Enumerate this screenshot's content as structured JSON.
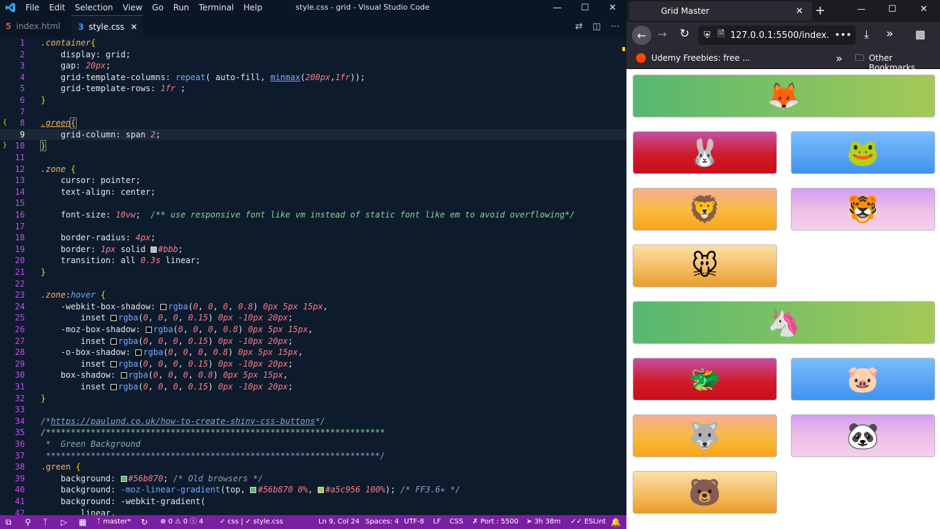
{
  "vscode": {
    "menu": [
      "File",
      "Edit",
      "Selection",
      "View",
      "Go",
      "Run",
      "Terminal",
      "Help"
    ],
    "title": "style.css - grid - Visual Studio Code",
    "tabs": [
      {
        "label": "index.html",
        "icon": "5"
      },
      {
        "label": "style.css",
        "icon": "3"
      }
    ],
    "lines": [
      {
        "n": "1",
        "html": "<span class='t-sel'>.container</span><span class='t-br'>{</span>"
      },
      {
        "n": "2",
        "html": "    <span class='t-prop'>display</span>: grid;"
      },
      {
        "n": "3",
        "html": "    <span class='t-prop'>gap</span>: <span class='t-num'>20px</span>;"
      },
      {
        "n": "4",
        "html": "    <span class='t-prop'>grid-template-columns</span>: <span class='t-fn'>repeat</span>( auto-fill, <span class='t-fn' style='text-decoration:underline'>minmax</span>(<span class='t-num'>200px</span>,<span class='t-num'>1fr</span>));"
      },
      {
        "n": "5",
        "html": "    <span class='t-prop'>grid-template-rows</span>: <span class='t-num'>1fr</span> ;"
      },
      {
        "n": "6",
        "html": "<span class='t-br'>}</span>"
      },
      {
        "n": "7",
        "html": ""
      },
      {
        "n": "8",
        "html": "<span class='t-sel' style='text-decoration:underline'>.green</span><span class='t-br' style='outline:1px solid #888'>{</span>"
      },
      {
        "n": "9",
        "html": "    <span class='t-prop'>grid-column</span>: span <span class='t-num'>2</span>;"
      },
      {
        "n": "10",
        "html": "<span class='t-br' style='outline:1px solid #888'>}</span>"
      },
      {
        "n": "11",
        "html": ""
      },
      {
        "n": "12",
        "html": "<span class='t-sel'>.zone</span> <span class='t-br'>{</span>"
      },
      {
        "n": "13",
        "html": "    <span class='t-prop'>cursor</span>: pointer;"
      },
      {
        "n": "14",
        "html": "    <span class='t-prop'>text-align</span>: center;"
      },
      {
        "n": "15",
        "html": ""
      },
      {
        "n": "16",
        "html": "    <span class='t-prop'>font-size</span>: <span class='t-num'>10vw</span>;  <span class='t-com-green'>/** use responsive font like vm instead of static font like em to avoid overflowing*/</span>"
      },
      {
        "n": "17",
        "html": ""
      },
      {
        "n": "18",
        "html": "    <span class='t-prop'>border-radius</span>: <span class='t-num'>4px</span>;"
      },
      {
        "n": "19",
        "html": "    <span class='t-prop'>border</span>: <span class='t-num'>1px</span> solid <span class='sw' style='background:#bbb'></span><span class='t-num'>#bbb</span>;"
      },
      {
        "n": "20",
        "html": "    <span class='t-prop'>transition</span>: all <span class='t-num'>0.3s</span> linear;"
      },
      {
        "n": "21",
        "html": "<span class='t-br'>}</span>"
      },
      {
        "n": "22",
        "html": ""
      },
      {
        "n": "23",
        "html": "<span class='t-sel'>.zone</span><span class='t-pun'>:</span><span class='t-fn' style='font-style:italic'>hover</span> <span class='t-br'>{</span>"
      },
      {
        "n": "24",
        "html": "    <span class='t-prop'>-webkit-box-shadow</span>: <span class='sw' style='background:#000'></span><span class='t-fn'>rgba</span>(<span class='t-num'>0</span>, <span class='t-num'>0</span>, <span class='t-num'>0</span>, <span class='t-num'>0.8</span>) <span class='t-num'>0px</span> <span class='t-num'>5px</span> <span class='t-num'>15px</span>,"
      },
      {
        "n": "25",
        "html": "        inset <span class='sw' style='background:#000'></span><span class='t-fn'>rgba</span>(<span class='t-num'>0</span>, <span class='t-num'>0</span>, <span class='t-num'>0</span>, <span class='t-num'>0.15</span>) <span class='t-num'>0px</span> <span class='t-num'>-10px</span> <span class='t-num'>20px</span>;"
      },
      {
        "n": "26",
        "html": "    <span class='t-prop'>-moz-box-shadow</span>: <span class='sw' style='background:#000'></span><span class='t-fn'>rgba</span>(<span class='t-num'>0</span>, <span class='t-num'>0</span>, <span class='t-num'>0</span>, <span class='t-num'>0.8</span>) <span class='t-num'>0px</span> <span class='t-num'>5px</span> <span class='t-num'>15px</span>,"
      },
      {
        "n": "27",
        "html": "        inset <span class='sw' style='background:#000'></span><span class='t-fn'>rgba</span>(<span class='t-num'>0</span>, <span class='t-num'>0</span>, <span class='t-num'>0</span>, <span class='t-num'>0.15</span>) <span class='t-num'>0px</span> <span class='t-num'>-10px</span> <span class='t-num'>20px</span>;"
      },
      {
        "n": "28",
        "html": "    <span class='t-prop'>-o-box-shadow</span>: <span class='sw' style='background:#000'></span><span class='t-fn'>rgba</span>(<span class='t-num'>0</span>, <span class='t-num'>0</span>, <span class='t-num'>0</span>, <span class='t-num'>0.8</span>) <span class='t-num'>0px</span> <span class='t-num'>5px</span> <span class='t-num'>15px</span>,"
      },
      {
        "n": "29",
        "html": "        inset <span class='sw' style='background:#000'></span><span class='t-fn'>rgba</span>(<span class='t-num'>0</span>, <span class='t-num'>0</span>, <span class='t-num'>0</span>, <span class='t-num'>0.15</span>) <span class='t-num'>0px</span> <span class='t-num'>-10px</span> <span class='t-num'>20px</span>;"
      },
      {
        "n": "30",
        "html": "    <span class='t-prop'>box-shadow</span>: <span class='sw' style='background:#000'></span><span class='t-fn'>rgba</span>(<span class='t-num'>0</span>, <span class='t-num'>0</span>, <span class='t-num'>0</span>, <span class='t-num'>0.8</span>) <span class='t-num'>0px</span> <span class='t-num'>5px</span> <span class='t-num'>15px</span>,"
      },
      {
        "n": "31",
        "html": "        inset <span class='sw' style='background:#000'></span><span class='t-fn'>rgba</span>(<span class='t-num'>0</span>, <span class='t-num'>0</span>, <span class='t-num'>0</span>, <span class='t-num'>0.15</span>) <span class='t-num'>0px</span> <span class='t-num'>-10px</span> <span class='t-num'>20px</span>;"
      },
      {
        "n": "32",
        "html": "<span class='t-br'>}</span>"
      },
      {
        "n": "33",
        "html": ""
      },
      {
        "n": "34",
        "html": "<span class='t-com'>/*<u>https://paulund.co.uk/how-to-create-shiny-css-buttons</u>*/</span>"
      },
      {
        "n": "35",
        "html": "<span class='t-com-green'>/********************************************************************</span>"
      },
      {
        "n": "36",
        "html": "<span class='t-com'> *  Green Background</span>"
      },
      {
        "n": "37",
        "html": "<span class='t-com'> *******************************************************************/</span>"
      },
      {
        "n": "38",
        "html": "<span class='t-sel' style='font-style:normal'>.green</span> <span class='t-br'>{</span>"
      },
      {
        "n": "39",
        "html": "    <span class='t-prop'>background</span>: <span class='sw' style='background:#56b870'></span><span class='t-num'>#56b870</span>; <span class='t-com'>/* Old browsers */</span>"
      },
      {
        "n": "40",
        "html": "    <span class='t-prop'>background</span>: <span class='t-fn'>-moz-linear-gradient</span>(top, <span class='sw' style='background:#56b870'></span><span class='t-num'>#56b870</span> <span class='t-num'>0%</span>, <span class='sw' style='background:#a5c956'></span><span class='t-num'>#a5c956</span> <span class='t-num'>100%</span>); <span class='t-com'>/* FF3.6+ */</span>"
      },
      {
        "n": "41",
        "html": "    <span class='t-prop'>background</span>: -webkit-gradient("
      },
      {
        "n": "42",
        "html": "        linear,"
      }
    ],
    "current_line": "9",
    "status": {
      "branch": "master*",
      "errors": "0",
      "warnings": "0",
      "info": "4",
      "lang_crumb": "css | ✓ style.css",
      "position": "Ln 9, Col 24",
      "spaces": "Spaces: 4",
      "encoding": "UTF-8",
      "eol": "LF",
      "language": "CSS",
      "port": "Port : 5500",
      "time": "3h 38m",
      "eslint": "ESLint"
    }
  },
  "browser": {
    "tab_title": "Grid Master",
    "url": "127.0.0.1:5500/index.",
    "bookmark": "Udemy Freebies: free ...",
    "other_bookmarks": "Other Bookmarks",
    "zones": [
      {
        "animal": "fox",
        "emoji": "🦊",
        "color": "green"
      },
      {
        "animal": "rabbit",
        "emoji": "🐰",
        "color": "red"
      },
      {
        "animal": "frog",
        "emoji": "🐸",
        "color": "blue"
      },
      {
        "animal": "lion",
        "emoji": "🦁",
        "color": "orange"
      },
      {
        "animal": "tiger",
        "emoji": "🐯",
        "color": "purple"
      },
      {
        "animal": "mouse",
        "emoji": "🐭",
        "color": "gold"
      },
      {
        "animal": "unicorn",
        "emoji": "🦄",
        "color": "green"
      },
      {
        "animal": "dragon",
        "emoji": "🐲",
        "color": "red"
      },
      {
        "animal": "pig",
        "emoji": "🐷",
        "color": "blue"
      },
      {
        "animal": "wolf",
        "emoji": "🐺",
        "color": "orange"
      },
      {
        "animal": "panda",
        "emoji": "🐼",
        "color": "purple"
      },
      {
        "animal": "bear",
        "emoji": "🐻",
        "color": "gold"
      }
    ]
  }
}
